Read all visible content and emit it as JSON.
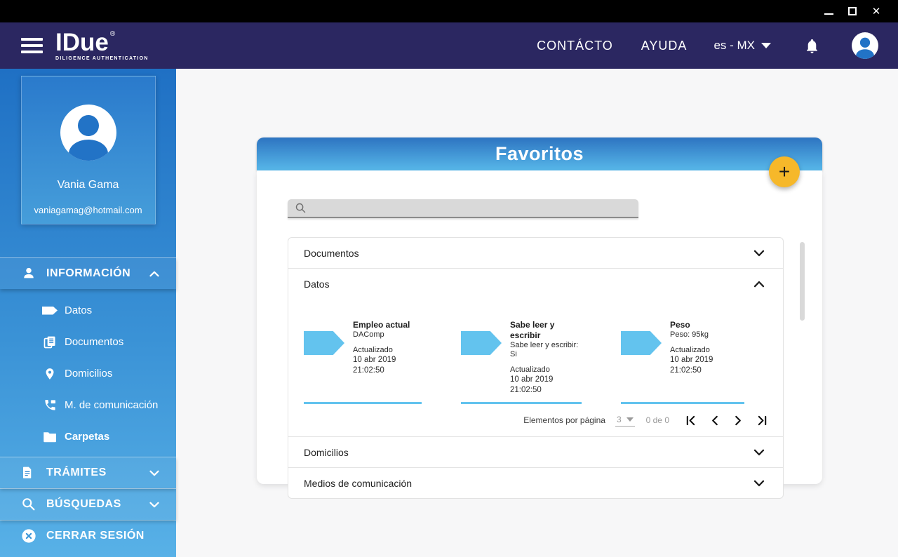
{
  "titlebar": {
    "controls": [
      "minimize",
      "maximize",
      "close"
    ]
  },
  "header": {
    "logo_title": "IDue",
    "logo_registered": "®",
    "logo_subtitle": "DILIGENCE AUTHENTICATION",
    "contact_label": "CONTÁCTO",
    "help_label": "AYUDA",
    "locale_label": "es - MX"
  },
  "sidebar": {
    "profile": {
      "name": "Vania Gama",
      "email": "vaniagamag@hotmail.com"
    },
    "information_label": "INFORMACIÓN",
    "items": [
      {
        "label": "Datos",
        "icon": "tag-icon",
        "active": false
      },
      {
        "label": "Documentos",
        "icon": "documents-icon",
        "active": false
      },
      {
        "label": "Domicilios",
        "icon": "location-pin-icon",
        "active": false
      },
      {
        "label": "M. de comunicación",
        "icon": "phone-icon",
        "active": false
      },
      {
        "label": "Carpetas",
        "icon": "folder-icon",
        "active": true
      }
    ],
    "tramites_label": "TRÁMITES",
    "busquedas_label": "BÚSQUEDAS",
    "logout_label": "CERRAR SESIÓN"
  },
  "main": {
    "title": "Favoritos",
    "add_label": "+",
    "search": {
      "value": "",
      "placeholder": ""
    },
    "accordion": [
      {
        "label": "Documentos",
        "state": "collapsed"
      },
      {
        "label": "Datos",
        "state": "expanded"
      },
      {
        "label": "Domicilios",
        "state": "collapsed"
      },
      {
        "label": "Medios de comunicación",
        "state": "collapsed"
      }
    ],
    "datos_cards": [
      {
        "title": "Empleo actual",
        "subtitle": "DAComp",
        "updated_label": "Actualizado",
        "updated_at": "10 abr 2019 21:02:50"
      },
      {
        "title": "Sabe leer y escribir",
        "subtitle": "Sabe leer y escribir: Si",
        "updated_label": "Actualizado",
        "updated_at": "10 abr 2019 21:02:50"
      },
      {
        "title": "Peso",
        "subtitle": "Peso: 95kg",
        "updated_label": "Actualizado",
        "updated_at": "10 abr 2019 21:02:50"
      }
    ],
    "pagination": {
      "items_per_page_label": "Elementos por página",
      "items_per_page_value": "3",
      "range_label": "0 de 0"
    }
  },
  "colors": {
    "titlebar": "#000000",
    "appbar_navy": "#2b2761",
    "sidebar_top": "#1f70c4",
    "sidebar_bottom": "#58b1e7",
    "header_gradient_top": "#2d74c1",
    "header_gradient_bottom": "#57b7e9",
    "accent_light_blue": "#63c3ee",
    "fab_yellow": "#f6b82a",
    "search_gray": "#d9d9d9"
  }
}
